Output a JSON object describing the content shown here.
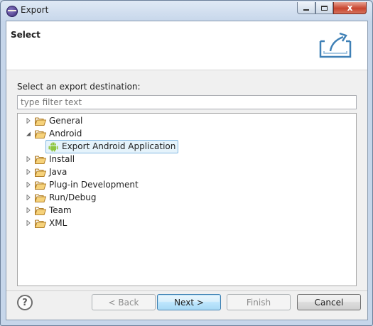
{
  "window": {
    "title": "Export",
    "close_glyph": "x"
  },
  "header": {
    "title": "Select",
    "icon": "export-icon"
  },
  "prompt": "Select an export destination:",
  "filter": {
    "placeholder": "type filter text",
    "value": ""
  },
  "tree": {
    "items": [
      {
        "label": "General",
        "expanded": false
      },
      {
        "label": "Android",
        "expanded": true
      },
      {
        "label": "Export Android Application",
        "selected": true,
        "icon": "android-icon"
      },
      {
        "label": "Install",
        "expanded": false
      },
      {
        "label": "Java",
        "expanded": false
      },
      {
        "label": "Plug-in Development",
        "expanded": false
      },
      {
        "label": "Run/Debug",
        "expanded": false
      },
      {
        "label": "Team",
        "expanded": false
      },
      {
        "label": "XML",
        "expanded": false
      }
    ]
  },
  "buttons": {
    "help": "?",
    "back": "< Back",
    "next": "Next >",
    "finish": "Finish",
    "cancel": "Cancel"
  },
  "colors": {
    "folder": "#e8b84a",
    "selection": "#e5f3fb",
    "android": "#8dc63f"
  }
}
